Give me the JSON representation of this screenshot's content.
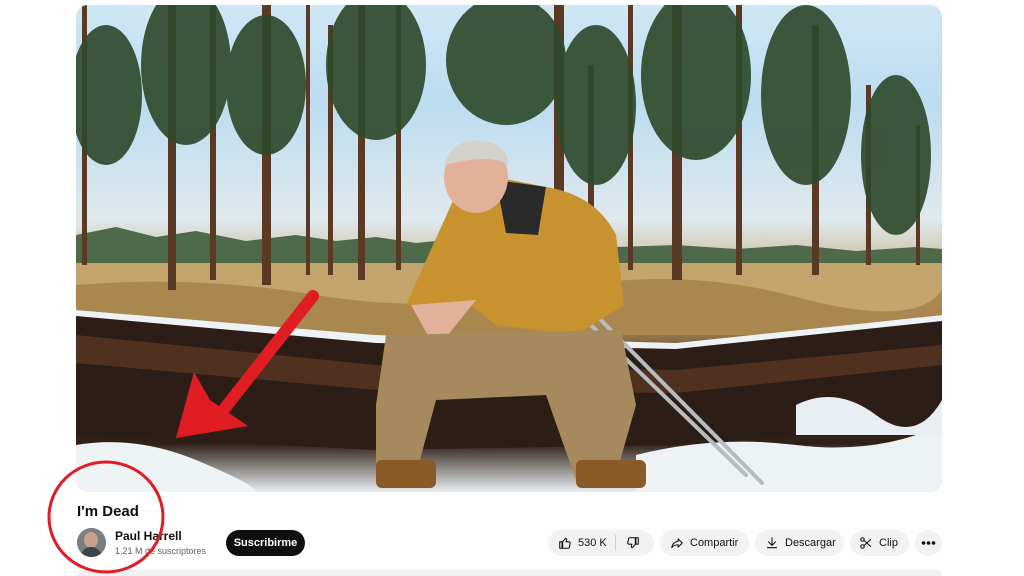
{
  "video": {
    "title": "I'm Dead"
  },
  "channel": {
    "name": "Paul Harrell",
    "subscribers": "1,21 M de suscriptores"
  },
  "actions": {
    "subscribe_label": "Suscribirme",
    "like_count": "530 K",
    "share_label": "Compartir",
    "download_label": "Descargar",
    "clip_label": "Clip"
  },
  "annotations": {
    "color": "#e11d24"
  }
}
